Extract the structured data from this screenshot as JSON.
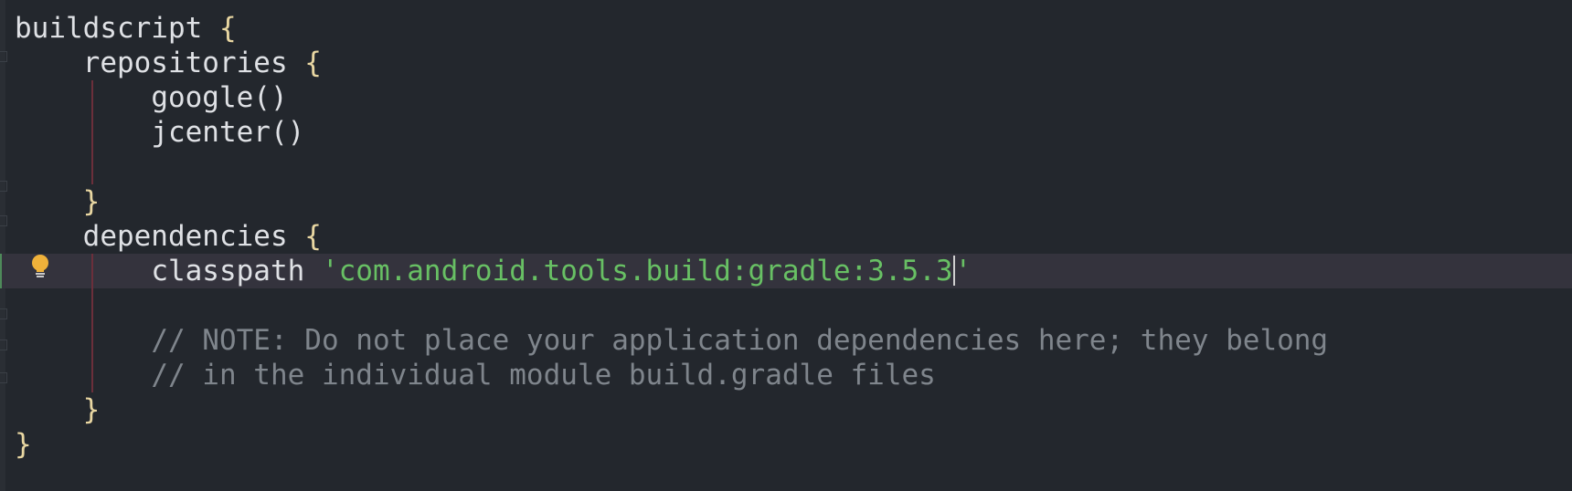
{
  "editor": {
    "lines": [
      {
        "indent": "",
        "text": "buildscript",
        "brace": " {"
      },
      {
        "indent": "    ",
        "text": "repositories",
        "brace": " {"
      },
      {
        "indent": "        ",
        "text": "google()"
      },
      {
        "indent": "        ",
        "text": "jcenter()"
      },
      {
        "text": ""
      },
      {
        "indent": "    ",
        "brace": "}"
      },
      {
        "indent": "    ",
        "text": "dependencies",
        "brace": " {"
      },
      {
        "indent": "        ",
        "text": "classpath ",
        "string_before_caret": "'com.android.tools.build:gradle:3.5.3",
        "string_after_caret": "'"
      },
      {
        "text": ""
      },
      {
        "indent": "        ",
        "comment": "// NOTE: Do not place your application dependencies here; they belong"
      },
      {
        "indent": "        ",
        "comment": "// in the individual module build.gradle files"
      },
      {
        "indent": "    ",
        "brace": "}"
      },
      {
        "indent": "",
        "brace": "}"
      }
    ],
    "current_line_index": 7,
    "intention_icon": "lightbulb-icon"
  },
  "colors": {
    "background": "#23272d",
    "current_line": "#34333d",
    "string": "#68c064",
    "comment": "#7f858c",
    "brace": "#e9d7a2",
    "default_text": "#dfe1e5",
    "indent_guide": "#6b2f3b",
    "intention_bulb": "#f0b23a"
  }
}
